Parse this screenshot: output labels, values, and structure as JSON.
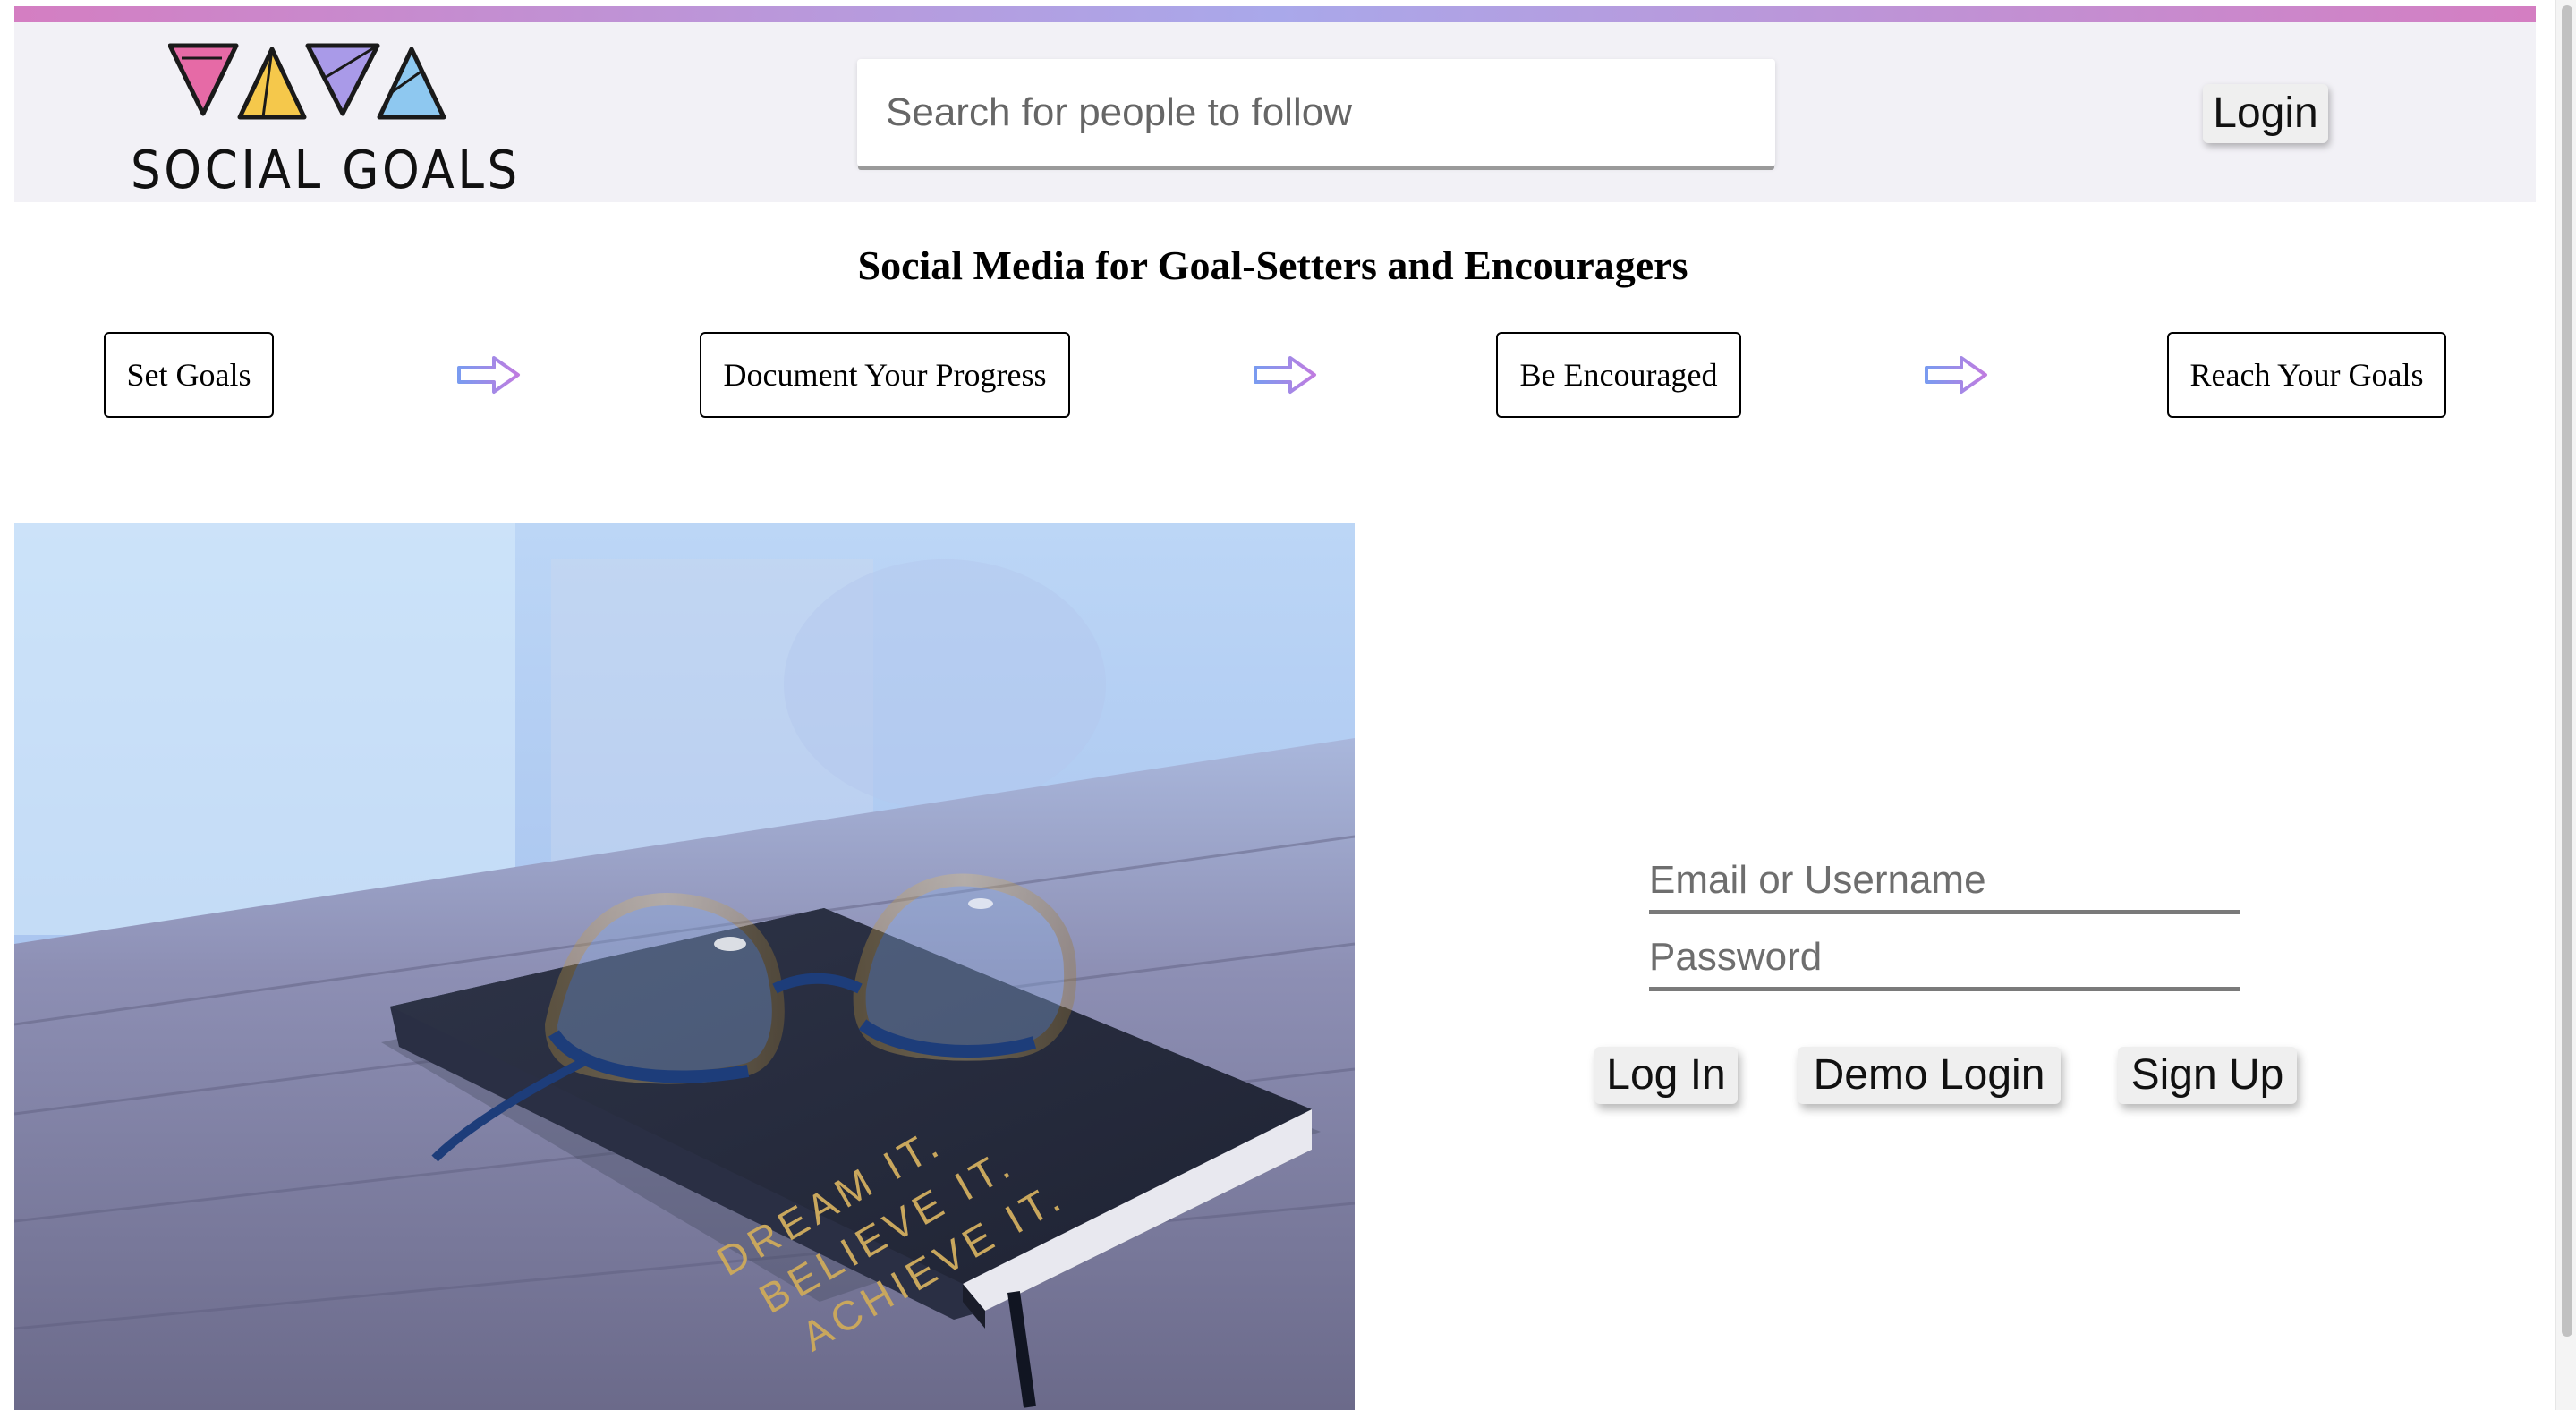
{
  "header": {
    "logo_text": "SOCIAL GOALS",
    "search_placeholder": "Search for people to follow",
    "login_label": "Login"
  },
  "headline": "Social Media for Goal-Setters and Encouragers",
  "steps": [
    {
      "label": "Set Goals"
    },
    {
      "label": "Document Your Progress"
    },
    {
      "label": "Be Encouraged"
    },
    {
      "label": "Reach Your Goals"
    }
  ],
  "hero": {
    "notebook_text": [
      "DREAM IT.",
      "BELIEVE IT.",
      "ACHIEVE IT."
    ]
  },
  "login_form": {
    "email_placeholder": "Email or Username",
    "password_placeholder": "Password",
    "login_label": "Log In",
    "demo_label": "Demo Login",
    "signup_label": "Sign Up"
  },
  "colors": {
    "brand_pink": "#e66aa6",
    "brand_yellow": "#f5c84b",
    "brand_purple": "#a99ae8",
    "brand_blue": "#8ec8f0",
    "header_bg": "#f2f1f6"
  }
}
